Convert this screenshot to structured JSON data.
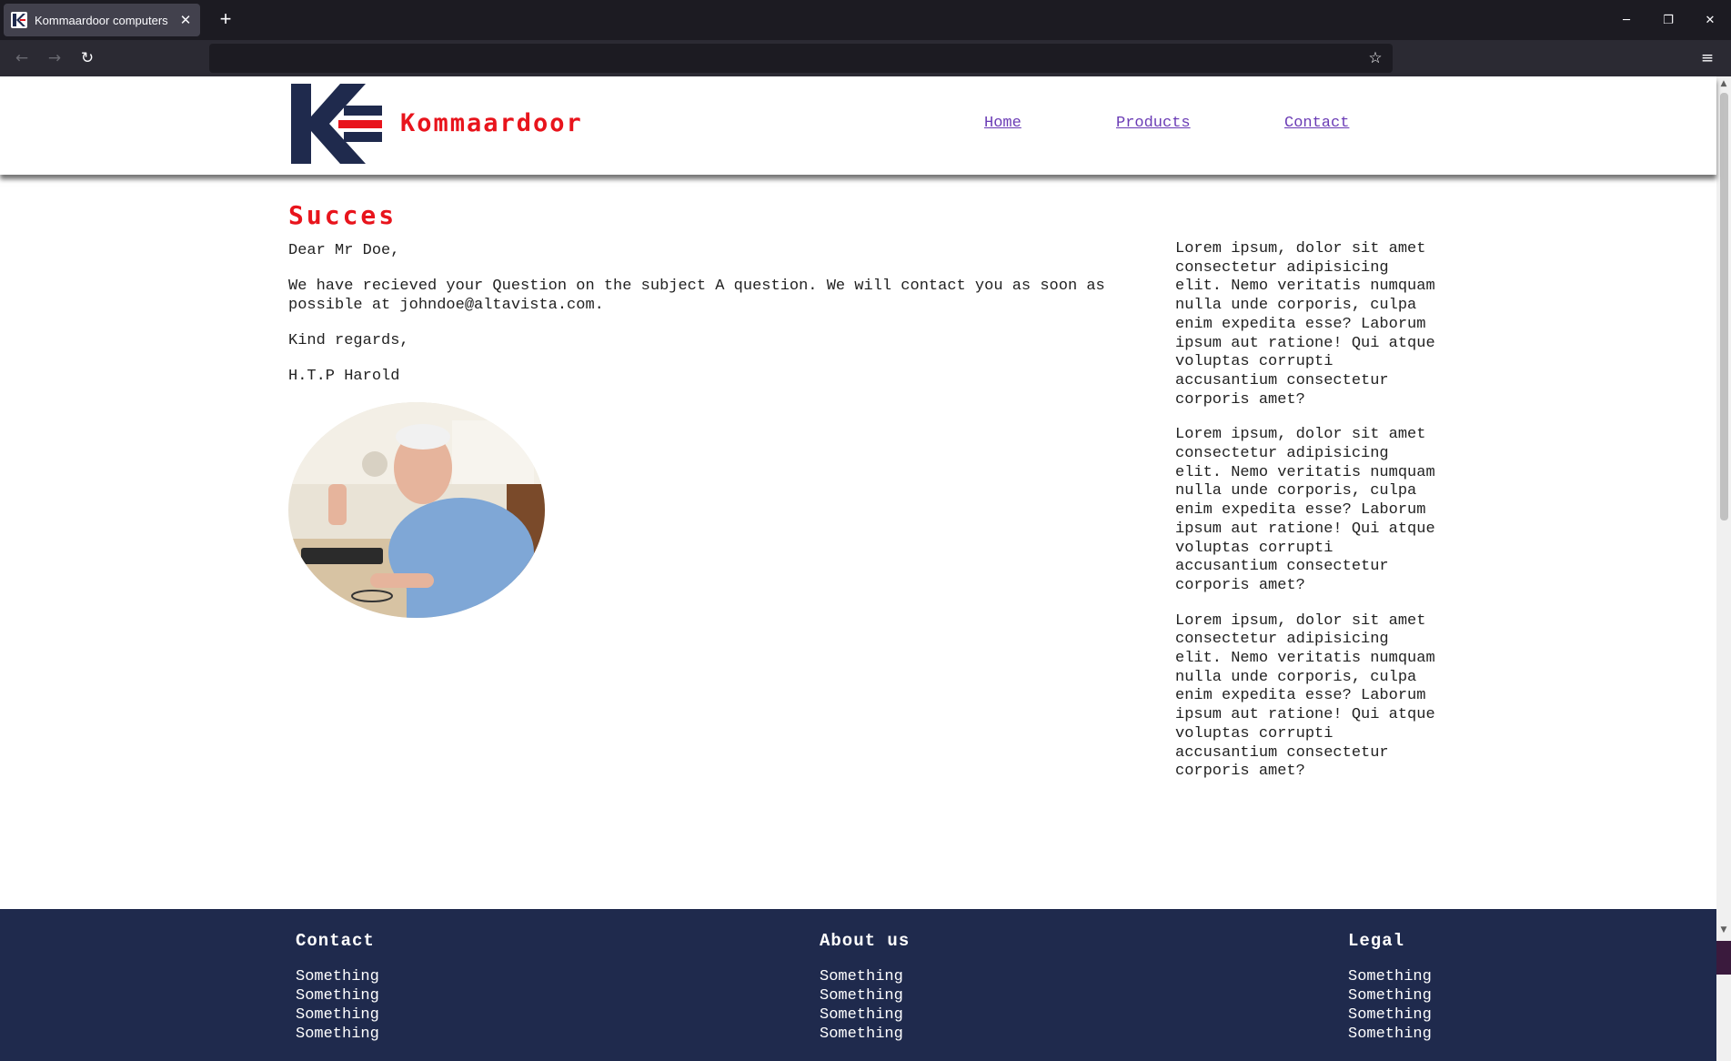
{
  "browser": {
    "tab_title": "Kommaardoor computers",
    "tab_close": "✕",
    "new_tab": "+",
    "url": "",
    "back": "←",
    "forward": "→",
    "reload": "↻",
    "bookmark": "☆",
    "menu": "≡",
    "minimize": "─",
    "restore": "❐",
    "close": "✕"
  },
  "header": {
    "brand": "Kommaardoor",
    "nav": [
      "Home",
      "Products",
      "Contact"
    ]
  },
  "main": {
    "title": "Succes",
    "greeting": "Dear Mr Doe,",
    "body": "We have recieved your Question on the subject A question. We will contact you as soon as possible at johndoe@altavista.com.",
    "closing": "Kind regards,",
    "signature": "H.T.P Harold"
  },
  "aside": {
    "paragraphs": [
      "Lorem ipsum, dolor sit amet consectetur adipisicing elit. Nemo veritatis numquam nulla unde corporis, culpa enim expedita esse? Laborum ipsum aut ratione! Qui atque voluptas corrupti accusantium consectetur corporis amet?",
      "Lorem ipsum, dolor sit amet consectetur adipisicing elit. Nemo veritatis numquam nulla unde corporis, culpa enim expedita esse? Laborum ipsum aut ratione! Qui atque voluptas corrupti accusantium consectetur corporis amet?",
      "Lorem ipsum, dolor sit amet consectetur adipisicing elit. Nemo veritatis numquam nulla unde corporis, culpa enim expedita esse? Laborum ipsum aut ratione! Qui atque voluptas corrupti accusantium consectetur corporis amet?"
    ]
  },
  "footer": {
    "columns": [
      {
        "heading": "Contact",
        "items": [
          "Something",
          "Something",
          "Something",
          "Something"
        ]
      },
      {
        "heading": "About us",
        "items": [
          "Something",
          "Something",
          "Something",
          "Something"
        ]
      },
      {
        "heading": "Legal",
        "items": [
          "Something",
          "Something",
          "Something",
          "Something"
        ]
      }
    ]
  },
  "colors": {
    "brand_red": "#e8141c",
    "navy": "#1f2a4d",
    "link": "#6a3bb5"
  }
}
